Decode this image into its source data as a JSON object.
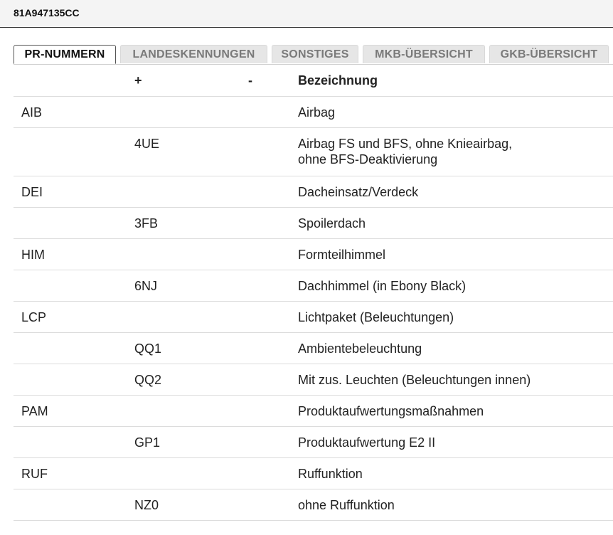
{
  "header": {
    "code": "81A947135CC"
  },
  "tabs": [
    {
      "label": "PR-NUMMERN",
      "active": true
    },
    {
      "label": "LANDESKENNUNGEN",
      "active": false
    },
    {
      "label": "SONSTIGES",
      "active": false
    },
    {
      "label": "MKB-ÜBERSICHT",
      "active": false
    },
    {
      "label": "GKB-ÜBERSICHT",
      "active": false
    }
  ],
  "table": {
    "columns": [
      "",
      "+",
      "-",
      "Bezeichnung"
    ],
    "rows": [
      {
        "family": "AIB",
        "plus": "",
        "minus": "",
        "desc": "Airbag"
      },
      {
        "family": "",
        "plus": "4UE",
        "minus": "",
        "desc_line1": "Airbag FS und BFS, ohne Knieairbag,",
        "desc_line2": "ohne BFS-Deaktivierung"
      },
      {
        "family": "DEI",
        "plus": "",
        "minus": "",
        "desc": "Dacheinsatz/Verdeck"
      },
      {
        "family": "",
        "plus": "3FB",
        "minus": "",
        "desc": "Spoilerdach"
      },
      {
        "family": "HIM",
        "plus": "",
        "minus": "",
        "desc": "Formteilhimmel"
      },
      {
        "family": "",
        "plus": "6NJ",
        "minus": "",
        "desc": "Dachhimmel (in Ebony Black)"
      },
      {
        "family": "LCP",
        "plus": "",
        "minus": "",
        "desc": "Lichtpaket (Beleuchtungen)"
      },
      {
        "family": "",
        "plus": "QQ1",
        "minus": "",
        "desc": "Ambientebeleuchtung"
      },
      {
        "family": "",
        "plus": "QQ2",
        "minus": "",
        "desc": "Mit zus. Leuchten (Beleuchtungen innen)"
      },
      {
        "family": "PAM",
        "plus": "",
        "minus": "",
        "desc": "Produktaufwertungsmaßnahmen"
      },
      {
        "family": "",
        "plus": "GP1",
        "minus": "",
        "desc": "Produktaufwertung E2 II"
      },
      {
        "family": "RUF",
        "plus": "",
        "minus": "",
        "desc": "Ruffunktion"
      },
      {
        "family": "",
        "plus": "NZ0",
        "minus": "",
        "desc": "ohne Ruffunktion"
      }
    ]
  }
}
